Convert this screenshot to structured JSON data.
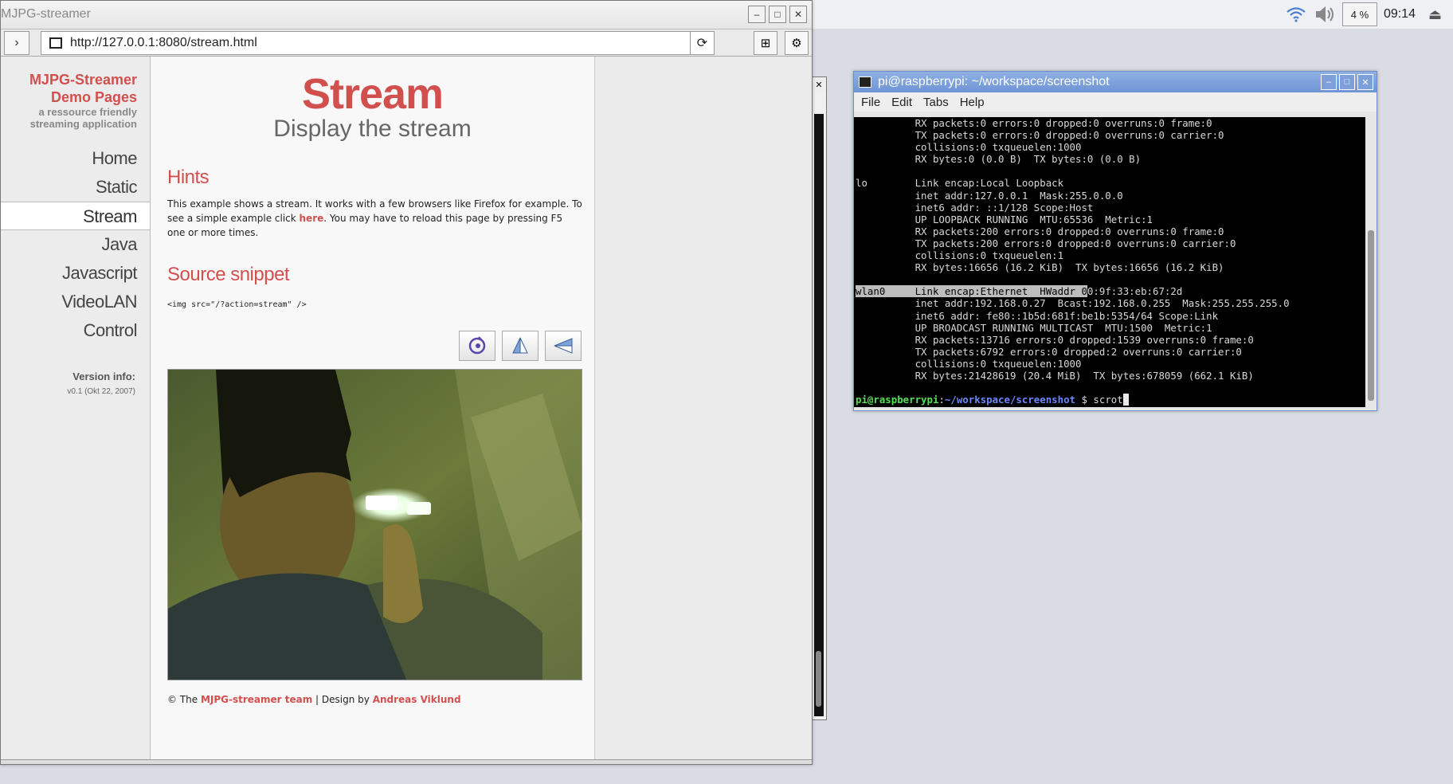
{
  "tray": {
    "cpu": "4 %",
    "clock": "09:14"
  },
  "browser": {
    "title": "MJPG-streamer",
    "url": "http://127.0.0.1:8080/stream.html",
    "sidebar": {
      "brand_line1": "MJPG-Streamer",
      "brand_line2": "Demo Pages",
      "tagline_line1": "a ressource friendly",
      "tagline_line2": "streaming application",
      "menu": [
        "Home",
        "Static",
        "Stream",
        "Java",
        "Javascript",
        "VideoLAN",
        "Control"
      ],
      "active_menu": "Stream",
      "version_label": "Version info:",
      "version_value": "v0.1 (Okt 22, 2007)"
    },
    "content": {
      "title": "Stream",
      "subtitle": "Display the stream",
      "hints_heading": "Hints",
      "hints_text_1": "This example shows a stream. It works with a few browsers like Firefox for example. To see a simple example click ",
      "hints_link": "here",
      "hints_text_2": ". You may have to reload this page by pressing F5 one or more times.",
      "snippet_heading": "Source snippet",
      "snippet_code": "<img src=\"/?action=stream\" />",
      "footer_prefix": "© The ",
      "footer_team": "MJPG-streamer team",
      "footer_mid": " | Design by ",
      "footer_designer": "Andreas Viklund"
    }
  },
  "terminal": {
    "title": "pi@raspberrypi: ~/workspace/screenshot",
    "menu": [
      "File",
      "Edit",
      "Tabs",
      "Help"
    ],
    "lines_before": [
      "          RX packets:0 errors:0 dropped:0 overruns:0 frame:0",
      "          TX packets:0 errors:0 dropped:0 overruns:0 carrier:0",
      "          collisions:0 txqueuelen:1000",
      "          RX bytes:0 (0.0 B)  TX bytes:0 (0.0 B)",
      "",
      "lo        Link encap:Local Loopback",
      "          inet addr:127.0.0.1  Mask:255.0.0.0",
      "          inet6 addr: ::1/128 Scope:Host",
      "          UP LOOPBACK RUNNING  MTU:65536  Metric:1",
      "          RX packets:200 errors:0 dropped:0 overruns:0 frame:0",
      "          TX packets:200 errors:0 dropped:0 overruns:0 carrier:0",
      "          collisions:0 txqueuelen:1",
      "          RX bytes:16656 (16.2 KiB)  TX bytes:16656 (16.2 KiB)",
      ""
    ],
    "wlan_highlight": "wlan0     Link encap:Ethernet  HWaddr 0",
    "wlan_rest": "0:9f:33:eb:67:2d",
    "lines_after": [
      "          inet addr:192.168.0.27  Bcast:192.168.0.255  Mask:255.255.255.0",
      "          inet6 addr: fe80::1b5d:681f:be1b:5354/64 Scope:Link",
      "          UP BROADCAST RUNNING MULTICAST  MTU:1500  Metric:1",
      "          RX packets:13716 errors:0 dropped:1539 overruns:0 frame:0",
      "          TX packets:6792 errors:0 dropped:2 overruns:0 carrier:0",
      "          collisions:0 txqueuelen:1000",
      "          RX bytes:21428619 (20.4 MiB)  TX bytes:678059 (662.1 KiB)",
      ""
    ],
    "prompt_user": "pi@raspberrypi",
    "prompt_sep": ":",
    "prompt_path": "~/workspace/screenshot",
    "prompt_dollar": " $ ",
    "command": "scrot"
  },
  "colors": {
    "accent": "#d1504e",
    "terminal_title": "#6e94d4"
  }
}
